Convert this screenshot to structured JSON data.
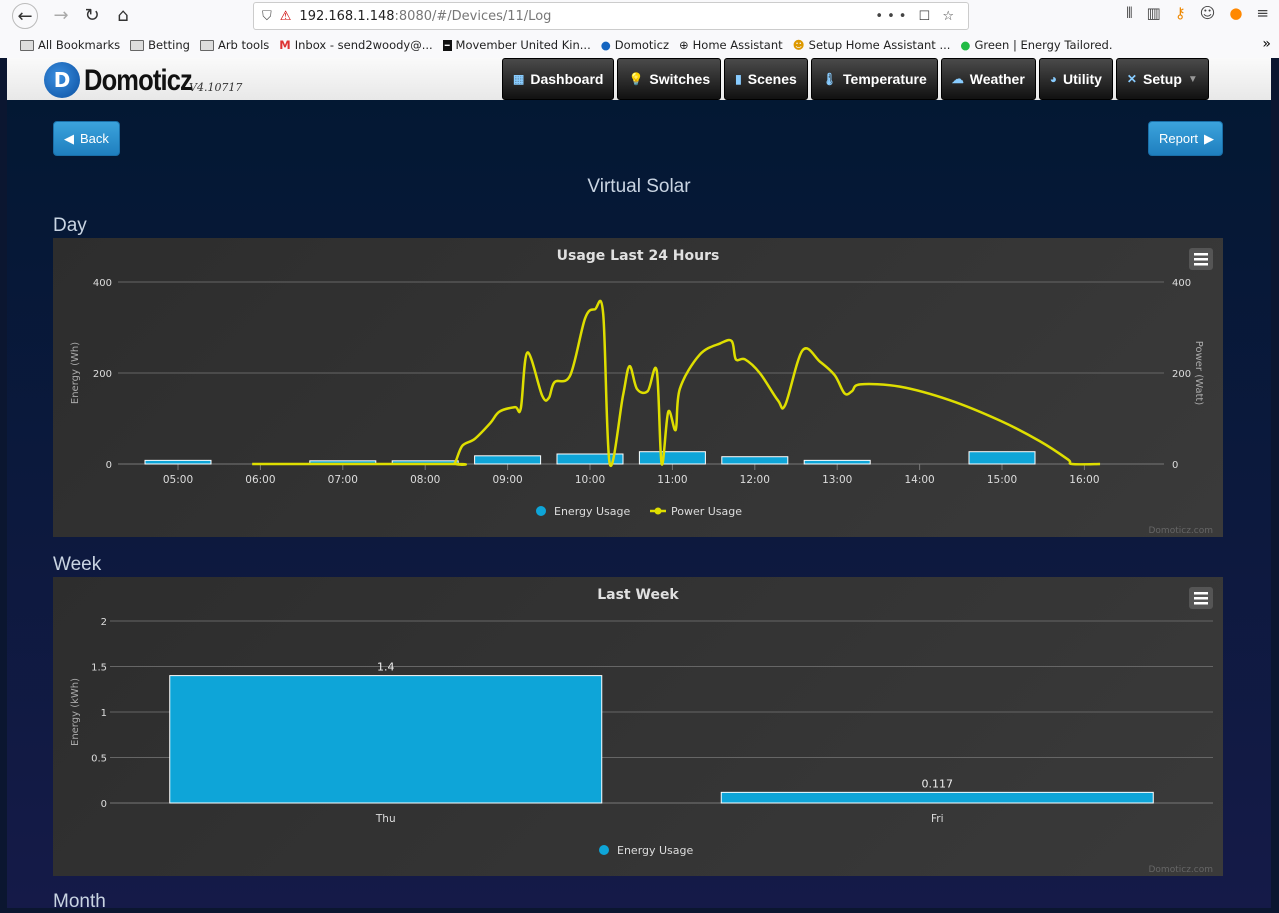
{
  "browser": {
    "url_host": "192.168.1.148",
    "url_rest": ":8080/#/Devices/11/Log",
    "bookmarks": [
      "All Bookmarks",
      "Betting",
      "Arb tools",
      "Inbox - send2woody@...",
      "Movember United Kin...",
      "Domoticz",
      "Home Assistant",
      "Setup Home Assistant ...",
      "Green | Energy Tailored."
    ]
  },
  "app": {
    "logo": "Domoticz",
    "version": "V4.10717",
    "menu": [
      {
        "label": "Dashboard",
        "icon": "dashboard-icon"
      },
      {
        "label": "Switches",
        "icon": "bulb-icon"
      },
      {
        "label": "Scenes",
        "icon": "clapper-icon"
      },
      {
        "label": "Temperature",
        "icon": "thermometer-icon"
      },
      {
        "label": "Weather",
        "icon": "cloud-icon"
      },
      {
        "label": "Utility",
        "icon": "utility-icon"
      },
      {
        "label": "Setup",
        "icon": "tools-icon"
      }
    ]
  },
  "page": {
    "back": "Back",
    "report": "Report",
    "title": "Virtual Solar",
    "sections": [
      "Day",
      "Week",
      "Month"
    ]
  },
  "colors": {
    "energy": "#0ea5d8",
    "power": "#dede00"
  },
  "chart_data": [
    {
      "type": "bar+line",
      "title": "Usage Last 24 Hours",
      "credit": "Domoticz.com",
      "ylabel": "Energy (Wh)",
      "y2label": "Power (Watt)",
      "ylim": [
        0,
        400
      ],
      "y2lim": [
        0,
        400
      ],
      "yticks": [
        0,
        200,
        400
      ],
      "categories": [
        "05:00",
        "06:00",
        "07:00",
        "08:00",
        "09:00",
        "10:00",
        "11:00",
        "12:00",
        "13:00",
        "14:00",
        "15:00",
        "16:00"
      ],
      "series": [
        {
          "name": "Energy Usage",
          "type": "bar",
          "values": [
            8,
            0,
            7,
            7,
            18,
            22,
            27,
            16,
            8,
            0,
            27,
            0
          ]
        },
        {
          "name": "Power Usage",
          "type": "line",
          "points": [
            [
              5.9,
              0
            ],
            [
              8.3,
              0
            ],
            [
              8.36,
              2
            ],
            [
              8.45,
              40
            ],
            [
              8.6,
              55
            ],
            [
              8.79,
              90
            ],
            [
              8.9,
              115
            ],
            [
              9.09,
              125
            ],
            [
              9.16,
              122
            ],
            [
              9.24,
              245
            ],
            [
              9.42,
              150
            ],
            [
              9.5,
              145
            ],
            [
              9.57,
              180
            ],
            [
              9.76,
              195
            ],
            [
              9.94,
              320
            ],
            [
              10.06,
              340
            ],
            [
              10.16,
              330
            ],
            [
              10.24,
              0
            ],
            [
              10.4,
              150
            ],
            [
              10.48,
              215
            ],
            [
              10.57,
              165
            ],
            [
              10.7,
              160
            ],
            [
              10.81,
              205
            ],
            [
              10.87,
              0
            ],
            [
              10.95,
              115
            ],
            [
              11.04,
              75
            ],
            [
              11.09,
              165
            ],
            [
              11.33,
              240
            ],
            [
              11.58,
              265
            ],
            [
              11.72,
              270
            ],
            [
              11.77,
              230
            ],
            [
              11.88,
              230
            ],
            [
              12.06,
              200
            ],
            [
              12.28,
              140
            ],
            [
              12.37,
              130
            ],
            [
              12.58,
              250
            ],
            [
              12.79,
              225
            ],
            [
              12.97,
              195
            ],
            [
              13.09,
              155
            ],
            [
              13.18,
              160
            ],
            [
              13.28,
              175
            ],
            [
              13.76,
              170
            ],
            [
              14.37,
              140
            ],
            [
              14.98,
              95
            ],
            [
              15.46,
              50
            ],
            [
              15.8,
              10
            ],
            [
              15.85,
              0
            ],
            [
              16.19,
              0
            ]
          ]
        }
      ]
    },
    {
      "type": "bar",
      "title": "Last Week",
      "credit": "Domoticz.com",
      "ylabel": "Energy (kWh)",
      "ylim": [
        0,
        2
      ],
      "yticks": [
        "0",
        "0.5",
        "1",
        "1.5",
        "2"
      ],
      "categories": [
        "Thu",
        "Fri"
      ],
      "series": [
        {
          "name": "Energy Usage",
          "values": [
            1.4,
            0.117
          ],
          "labels": [
            "1.4",
            "0.117"
          ]
        }
      ]
    }
  ]
}
